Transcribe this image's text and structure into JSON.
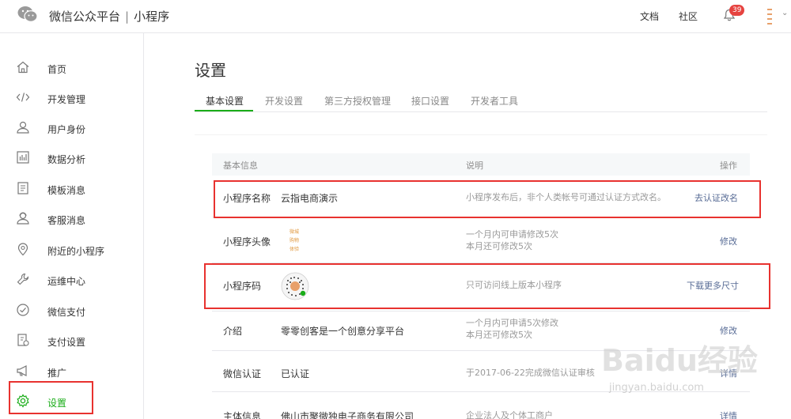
{
  "header": {
    "brand_name": "微信公众平台",
    "separator": "|",
    "product_name": "小程序",
    "docs_link": "文档",
    "community_link": "社区",
    "notification_count": "39"
  },
  "sidebar": {
    "items": [
      {
        "label": "首页",
        "icon": "home-icon"
      },
      {
        "label": "开发管理",
        "icon": "code-icon"
      },
      {
        "label": "用户身份",
        "icon": "user-icon"
      },
      {
        "label": "数据分析",
        "icon": "chart-icon"
      },
      {
        "label": "模板消息",
        "icon": "document-icon"
      },
      {
        "label": "客服消息",
        "icon": "service-icon"
      },
      {
        "label": "附近的小程序",
        "icon": "location-icon"
      },
      {
        "label": "运维中心",
        "icon": "wrench-icon"
      },
      {
        "label": "微信支付",
        "icon": "pay-icon"
      },
      {
        "label": "支付设置",
        "icon": "pay-settings-icon"
      },
      {
        "label": "推广",
        "icon": "megaphone-icon"
      },
      {
        "label": "设置",
        "icon": "gear-icon",
        "active": true
      }
    ]
  },
  "main": {
    "title": "设置",
    "tabs": [
      {
        "label": "基本设置",
        "active": true
      },
      {
        "label": "开发设置"
      },
      {
        "label": "第三方授权管理"
      },
      {
        "label": "接口设置"
      },
      {
        "label": "开发者工具"
      }
    ],
    "table": {
      "headers": {
        "info": "基本信息",
        "desc": "说明",
        "action": "操作"
      },
      "rows": [
        {
          "name": "小程序名称",
          "value": "云指电商演示",
          "desc1": "小程序发布后，非个人类帐号可通过认证方式改名。",
          "desc2": "",
          "action": "去认证改名"
        },
        {
          "name": "小程序头像",
          "value": "",
          "avatar_text": [
            "微城",
            "购物",
            "体验"
          ],
          "desc1": "一个月内可申请修改5次",
          "desc2": "本月还可修改5次",
          "action": "修改"
        },
        {
          "name": "小程序码",
          "value": "",
          "desc1": "只可访问线上版本小程序",
          "desc2": "",
          "action": "下载更多尺寸"
        },
        {
          "name": "介绍",
          "value": "零零创客是一个创意分享平台",
          "desc1": "一个月内可申请5次修改",
          "desc2": "本月还可修改5次",
          "action": "修改"
        },
        {
          "name": "微信认证",
          "value": "已认证",
          "desc1": "于2017-06-22完成微信认证审核",
          "desc2": "",
          "action": "详情"
        },
        {
          "name": "主体信息",
          "value": "佛山市聚微独电子商务有限公司",
          "desc1": "企业法人及个体工商户",
          "desc2": "",
          "action": "详情"
        }
      ]
    }
  },
  "watermark": {
    "line1": "Baidu经验",
    "line2": "jingyan.baidu.com"
  },
  "colors": {
    "accent_green": "#1aad19",
    "link_blue": "#576b95",
    "highlight_red": "#e8322f",
    "badge_red": "#e64340"
  }
}
